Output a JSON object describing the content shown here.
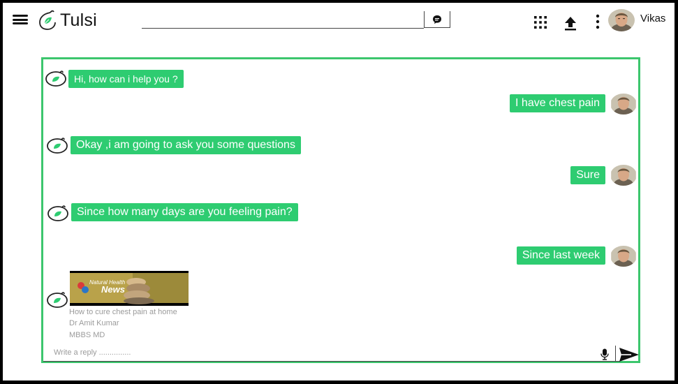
{
  "header": {
    "brand": "Tulsi",
    "search_value": "",
    "user_name": "Vikas"
  },
  "messages": [
    {
      "from": "bot",
      "text": "Hi, how can i help you ?"
    },
    {
      "from": "user",
      "text": "I have chest pain"
    },
    {
      "from": "bot",
      "text": "Okay ,i am going to ask you some questions"
    },
    {
      "from": "user",
      "text": "Sure"
    },
    {
      "from": "bot",
      "text": "Since how many days are you feeling pain?"
    },
    {
      "from": "user",
      "text": "Since last week"
    }
  ],
  "video": {
    "thumb_title_line1": "Natural Health",
    "thumb_title_line2": "News",
    "caption_title": "How to cure chest pain at home",
    "caption_author": "Dr Amit Kumar",
    "caption_degree": "MBBS MD"
  },
  "composer": {
    "placeholder": "Write a reply ..............."
  },
  "colors": {
    "accent": "#2ecc71",
    "panel_border": "#3cc66d"
  }
}
